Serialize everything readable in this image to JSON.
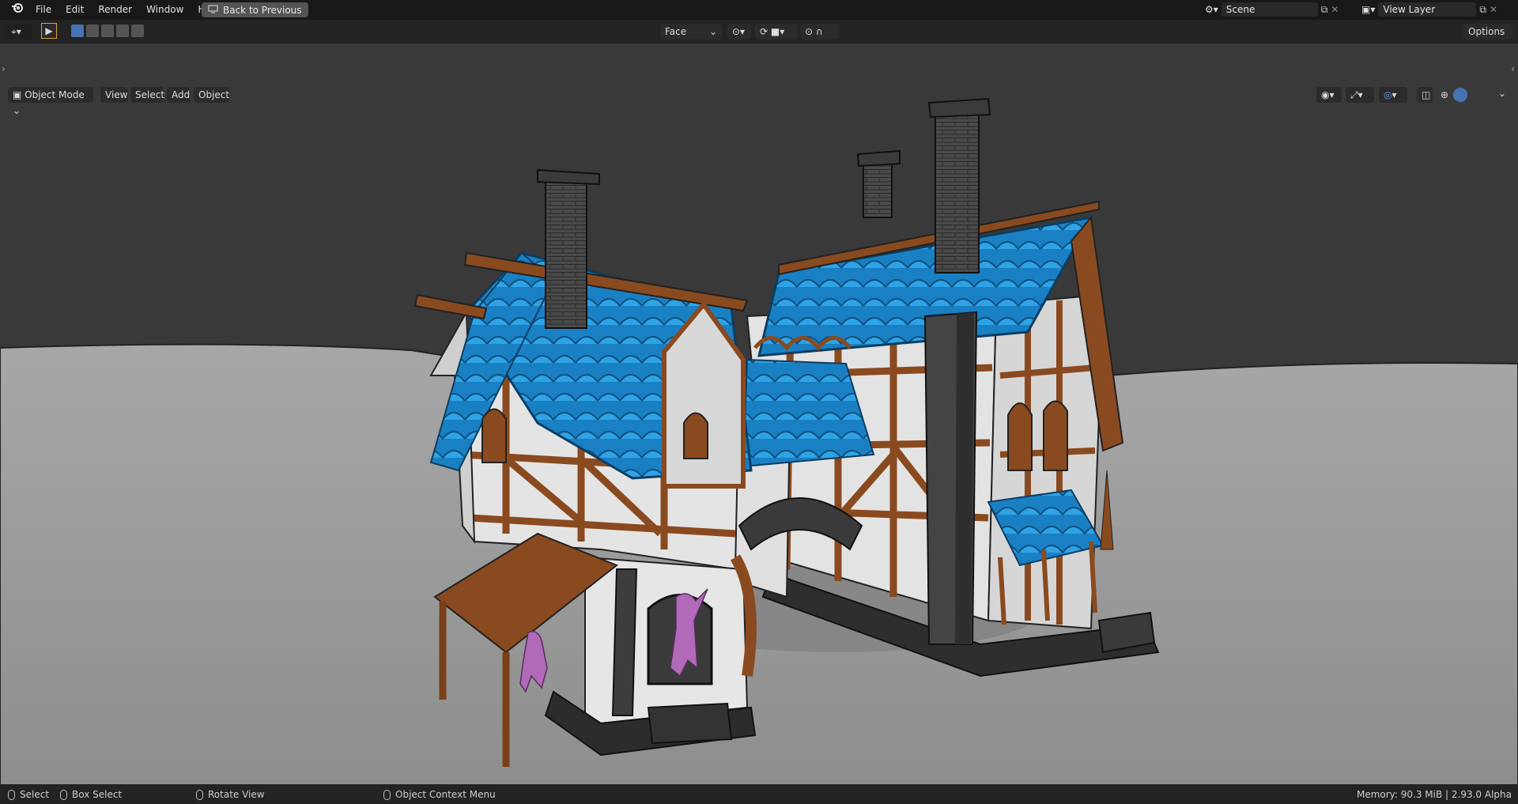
{
  "menu": {
    "file": "File",
    "edit": "Edit",
    "render": "Render",
    "window": "Window",
    "help": "Help",
    "back_to_previous": "Back to Previous"
  },
  "scene": {
    "value": "Scene"
  },
  "view_layer": {
    "value": "View Layer"
  },
  "tool_settings": {
    "select_mode": "Face",
    "options": "Options"
  },
  "viewport_header": {
    "mode": "Object Mode",
    "view": "View",
    "select": "Select",
    "add": "Add",
    "object": "Object"
  },
  "status": {
    "select": "Select",
    "box_select": "Box Select",
    "rotate_view": "Rotate View",
    "context_menu": "Object Context Menu",
    "memory": "Memory: 90.3 MiB | 2.93.0 Alpha"
  },
  "colors": {
    "roof_blue": "#1e8fd6",
    "wood_brown": "#8a4a1f",
    "plaster": "#e2e2e2",
    "stone": "#3d3d3d",
    "figure": "#b06ab8",
    "ground": "#9a9a9a"
  }
}
